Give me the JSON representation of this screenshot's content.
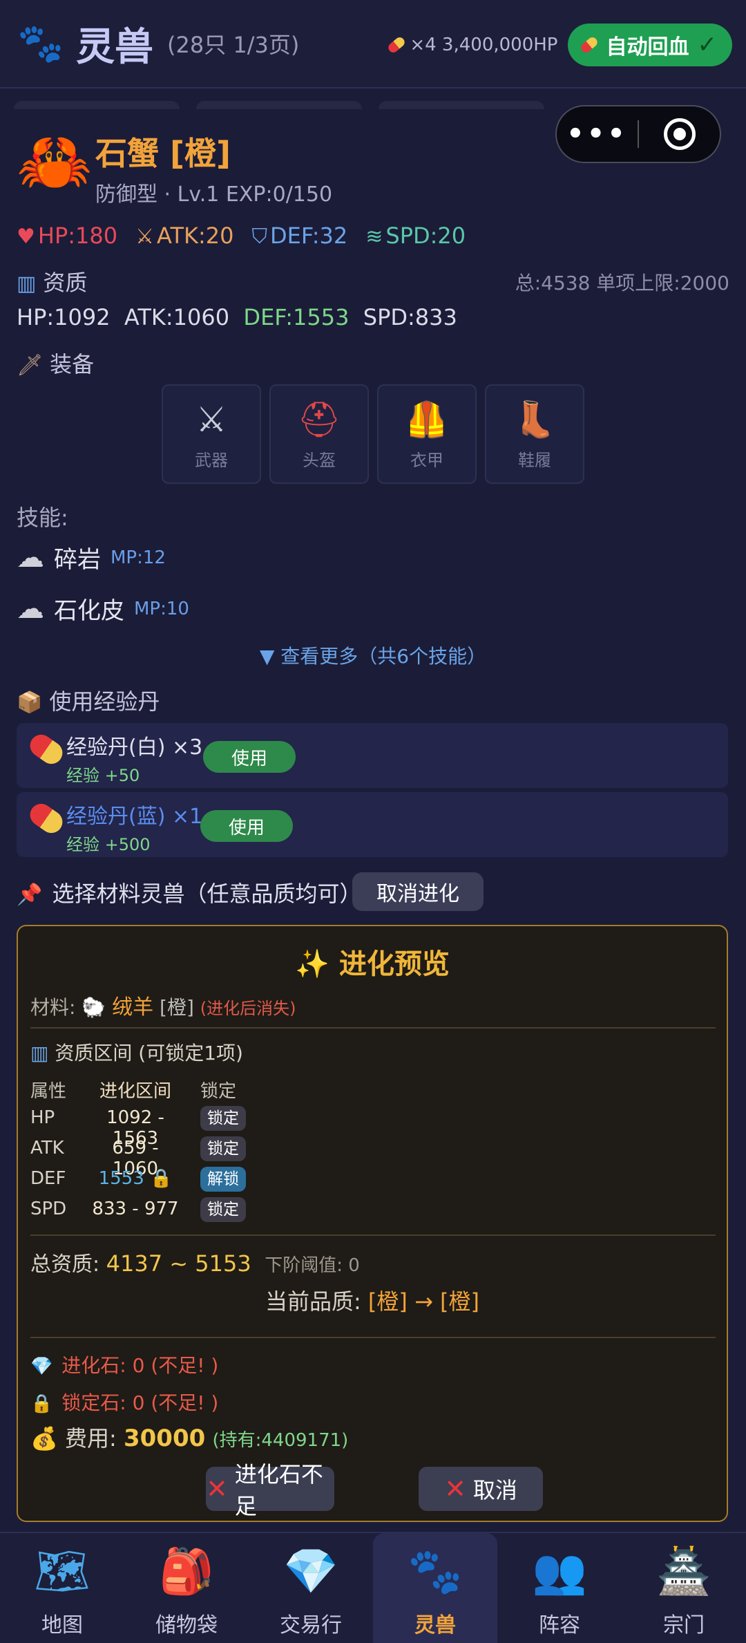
{
  "header": {
    "title": "灵兽",
    "subtitle": "(28只 1/3页)",
    "potion_info": "×4 3,400,000HP",
    "auto_heal_label": "自动回血"
  },
  "beast": {
    "name": "石蟹 [橙]",
    "meta": "防御型 · Lv.1 EXP:0/150",
    "stats": {
      "hp": "HP:180",
      "atk": "ATK:20",
      "def": "DEF:32",
      "spd": "SPD:20"
    },
    "aptitude_title": "资质",
    "aptitude_total": "总:4538 单项上限:2000",
    "aptitude": {
      "hp": "HP:1092",
      "atk": "ATK:1060",
      "def": "DEF:1553",
      "spd": "SPD:833"
    }
  },
  "equipment": {
    "title": "装备",
    "slots": [
      {
        "label": "武器",
        "icon": "crossed-swords"
      },
      {
        "label": "头盔",
        "icon": "helmet"
      },
      {
        "label": "衣甲",
        "icon": "vest"
      },
      {
        "label": "鞋履",
        "icon": "boot"
      }
    ]
  },
  "skills": {
    "title": "技能:",
    "items": [
      {
        "name": "碎岩",
        "mp": "MP:12"
      },
      {
        "name": "石化皮",
        "mp": "MP:10"
      }
    ],
    "more": "▼ 查看更多（共6个技能）"
  },
  "exp_pills": {
    "title": "使用经验丹",
    "items": [
      {
        "name": "经验丹(白) ×3",
        "gain": "经验 +50",
        "button": "使用"
      },
      {
        "name": "经验丹(蓝) ×1",
        "gain": "经验 +500",
        "button": "使用"
      }
    ]
  },
  "material": {
    "title": "选择材料灵兽（任意品质均可）",
    "cancel_label": "取消进化"
  },
  "evolution": {
    "title": "✨ 进化预览",
    "material_label": "材料:",
    "material_name": "绒羊",
    "material_quality": "[橙]",
    "material_note": "(进化后消失)",
    "range_title": "资质区间 (可锁定1项)",
    "table_headers": [
      "属性",
      "进化区间",
      "锁定"
    ],
    "rows": [
      {
        "attr": "HP",
        "range": "1092 - 1563",
        "lock": "锁定"
      },
      {
        "attr": "ATK",
        "range": "659 - 1060",
        "lock": "锁定"
      },
      {
        "attr": "DEF",
        "range": "1553",
        "lock": "解锁"
      },
      {
        "attr": "SPD",
        "range": "833 - 977",
        "lock": "锁定"
      }
    ],
    "total_label": "总资质:",
    "total_value": "4137 ~ 5153",
    "threshold": "下阶阈值: 0",
    "quality_label": "当前品质:",
    "quality_value": "[橙] → [橙]",
    "evo_stone": "进化石: 0 (不足! )",
    "lock_stone": "锁定石: 0 (不足! )",
    "fee_label": "费用:",
    "fee_value": "30000",
    "fee_held": "(持有:4409171)",
    "btn_insufficient": "进化石不足",
    "btn_cancel": "取消"
  },
  "nav": [
    {
      "label": "地图",
      "icon": "map-icon"
    },
    {
      "label": "储物袋",
      "icon": "backpack-icon"
    },
    {
      "label": "交易行",
      "icon": "diamond-icon"
    },
    {
      "label": "灵兽",
      "icon": "paw-icon",
      "active": true
    },
    {
      "label": "阵容",
      "icon": "team-icon"
    },
    {
      "label": "宗门",
      "icon": "castle-icon"
    }
  ],
  "colors": {
    "accent_orange": "#f2a33a",
    "auto_heal_green": "#1f9f52",
    "evo_border": "#a47d2c"
  }
}
